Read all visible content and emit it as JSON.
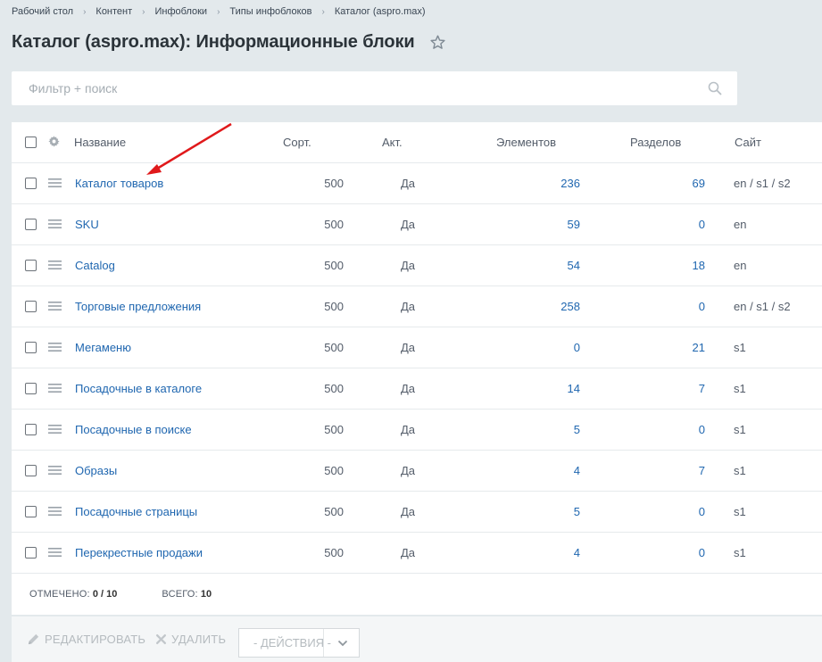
{
  "breadcrumb": [
    "Рабочий стол",
    "Контент",
    "Инфоблоки",
    "Типы инфоблоков",
    "Каталог (aspro.max)"
  ],
  "page_title": "Каталог (aspro.max): Информационные блоки",
  "filter": {
    "placeholder": "Фильтр + поиск"
  },
  "columns": {
    "name": "Название",
    "sort": "Сорт.",
    "active": "Акт.",
    "elements": "Элементов",
    "sections": "Разделов",
    "site": "Сайт"
  },
  "rows": [
    {
      "name": "Каталог товаров",
      "sort": "500",
      "active": "Да",
      "elements": "236",
      "sections": "69",
      "site": "en / s1 / s2"
    },
    {
      "name": "SKU",
      "sort": "500",
      "active": "Да",
      "elements": "59",
      "sections": "0",
      "site": "en"
    },
    {
      "name": "Catalog",
      "sort": "500",
      "active": "Да",
      "elements": "54",
      "sections": "18",
      "site": "en"
    },
    {
      "name": "Торговые предложения",
      "sort": "500",
      "active": "Да",
      "elements": "258",
      "sections": "0",
      "site": "en / s1 / s2"
    },
    {
      "name": "Мегаменю",
      "sort": "500",
      "active": "Да",
      "elements": "0",
      "sections": "21",
      "site": "s1"
    },
    {
      "name": "Посадочные в каталоге",
      "sort": "500",
      "active": "Да",
      "elements": "14",
      "sections": "7",
      "site": "s1"
    },
    {
      "name": "Посадочные в поиске",
      "sort": "500",
      "active": "Да",
      "elements": "5",
      "sections": "0",
      "site": "s1"
    },
    {
      "name": "Образы",
      "sort": "500",
      "active": "Да",
      "elements": "4",
      "sections": "7",
      "site": "s1"
    },
    {
      "name": "Посадочные страницы",
      "sort": "500",
      "active": "Да",
      "elements": "5",
      "sections": "0",
      "site": "s1"
    },
    {
      "name": "Перекрестные продажи",
      "sort": "500",
      "active": "Да",
      "elements": "4",
      "sections": "0",
      "site": "s1"
    }
  ],
  "summary": {
    "selected_label": "Отмечено:",
    "selected_value": "0 / 10",
    "total_label": "Всего:",
    "total_value": "10"
  },
  "actions": {
    "edit": "Редактировать",
    "delete": "Удалить",
    "dropdown": "- Действия -"
  },
  "colors": {
    "link": "#2067b0",
    "background": "#e3e9ec",
    "annotation_arrow": "#e0191b"
  }
}
